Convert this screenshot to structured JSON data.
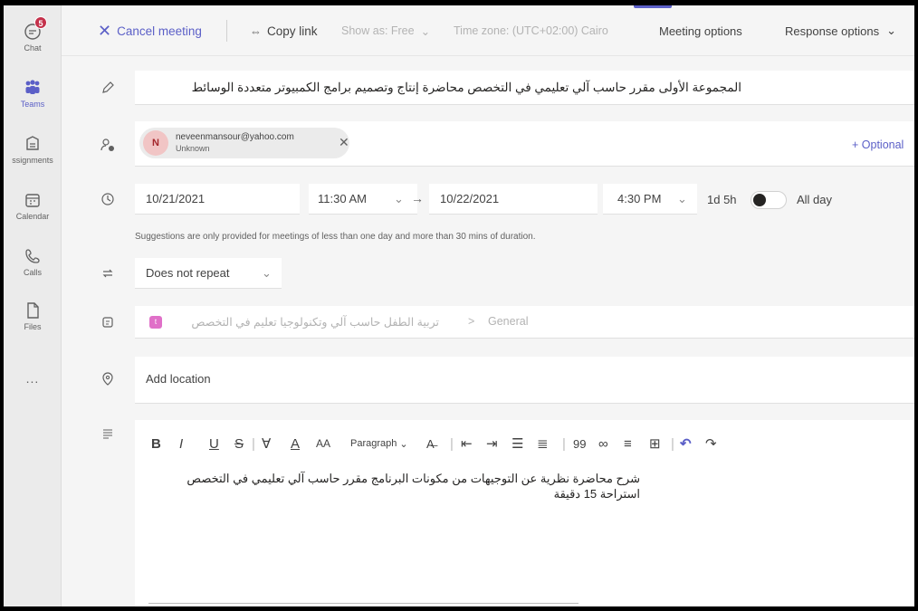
{
  "rail": {
    "chat_label": "Chat",
    "chat_badge": "5",
    "teams_label": "Teams",
    "assignments_label": "ssignments",
    "calendar_label": "Calendar",
    "calls_label": "Calls",
    "files_label": "Files",
    "more": "..."
  },
  "toolbar": {
    "cancel_label": "Cancel meeting",
    "copy_link_label": "Copy link",
    "show_as": "Show as: Free",
    "time_zone": "Time zone: (UTC+02:00) Cairo",
    "meeting_options": "Meeting options",
    "response_options": "Response options"
  },
  "form": {
    "title": "المجموعة الأولى مقرر حاسب آلي تعليمي في التخصص محاضرة إنتاج وتصميم برامج الكمبيوتر متعددة الوسائط",
    "attendee": {
      "initial": "N",
      "email": "neveenmansour@yahoo.com",
      "status": "Unknown"
    },
    "optional_label": "+ Optional",
    "start_date": "10/21/2021",
    "start_time": "11:30 AM",
    "end_date": "10/22/2021",
    "end_time": "4:30 PM",
    "duration": "1d 5h",
    "all_day_label": "All day",
    "suggestion_hint": "Suggestions are only provided for meetings of less than one day and more than 30 mins of duration.",
    "repeat": "Does not repeat",
    "channel_team": "تربية الطفل حاسب آلي وتكنولوجيا تعليم في التخصص",
    "channel_sep": ">",
    "channel_name": "General",
    "location_placeholder": "Add location"
  },
  "editor": {
    "toolbar": [
      "B",
      "I",
      "U",
      "S",
      "|",
      "∀",
      "A",
      "AA",
      "Paragraph",
      "|",
      "99",
      "∞",
      "≡",
      "⊞",
      "↶",
      "↷"
    ],
    "paragraph_label": "Paragraph",
    "line1": "شرح محاضرة نظرية عن التوجيهات من مكونات البرنامج مقرر حاسب آلي تعليمي في التخصص",
    "line2": "استراحة 15 دقيقة"
  },
  "colors": {
    "accent": "#5b5fc7",
    "badge": "#c4314b"
  }
}
